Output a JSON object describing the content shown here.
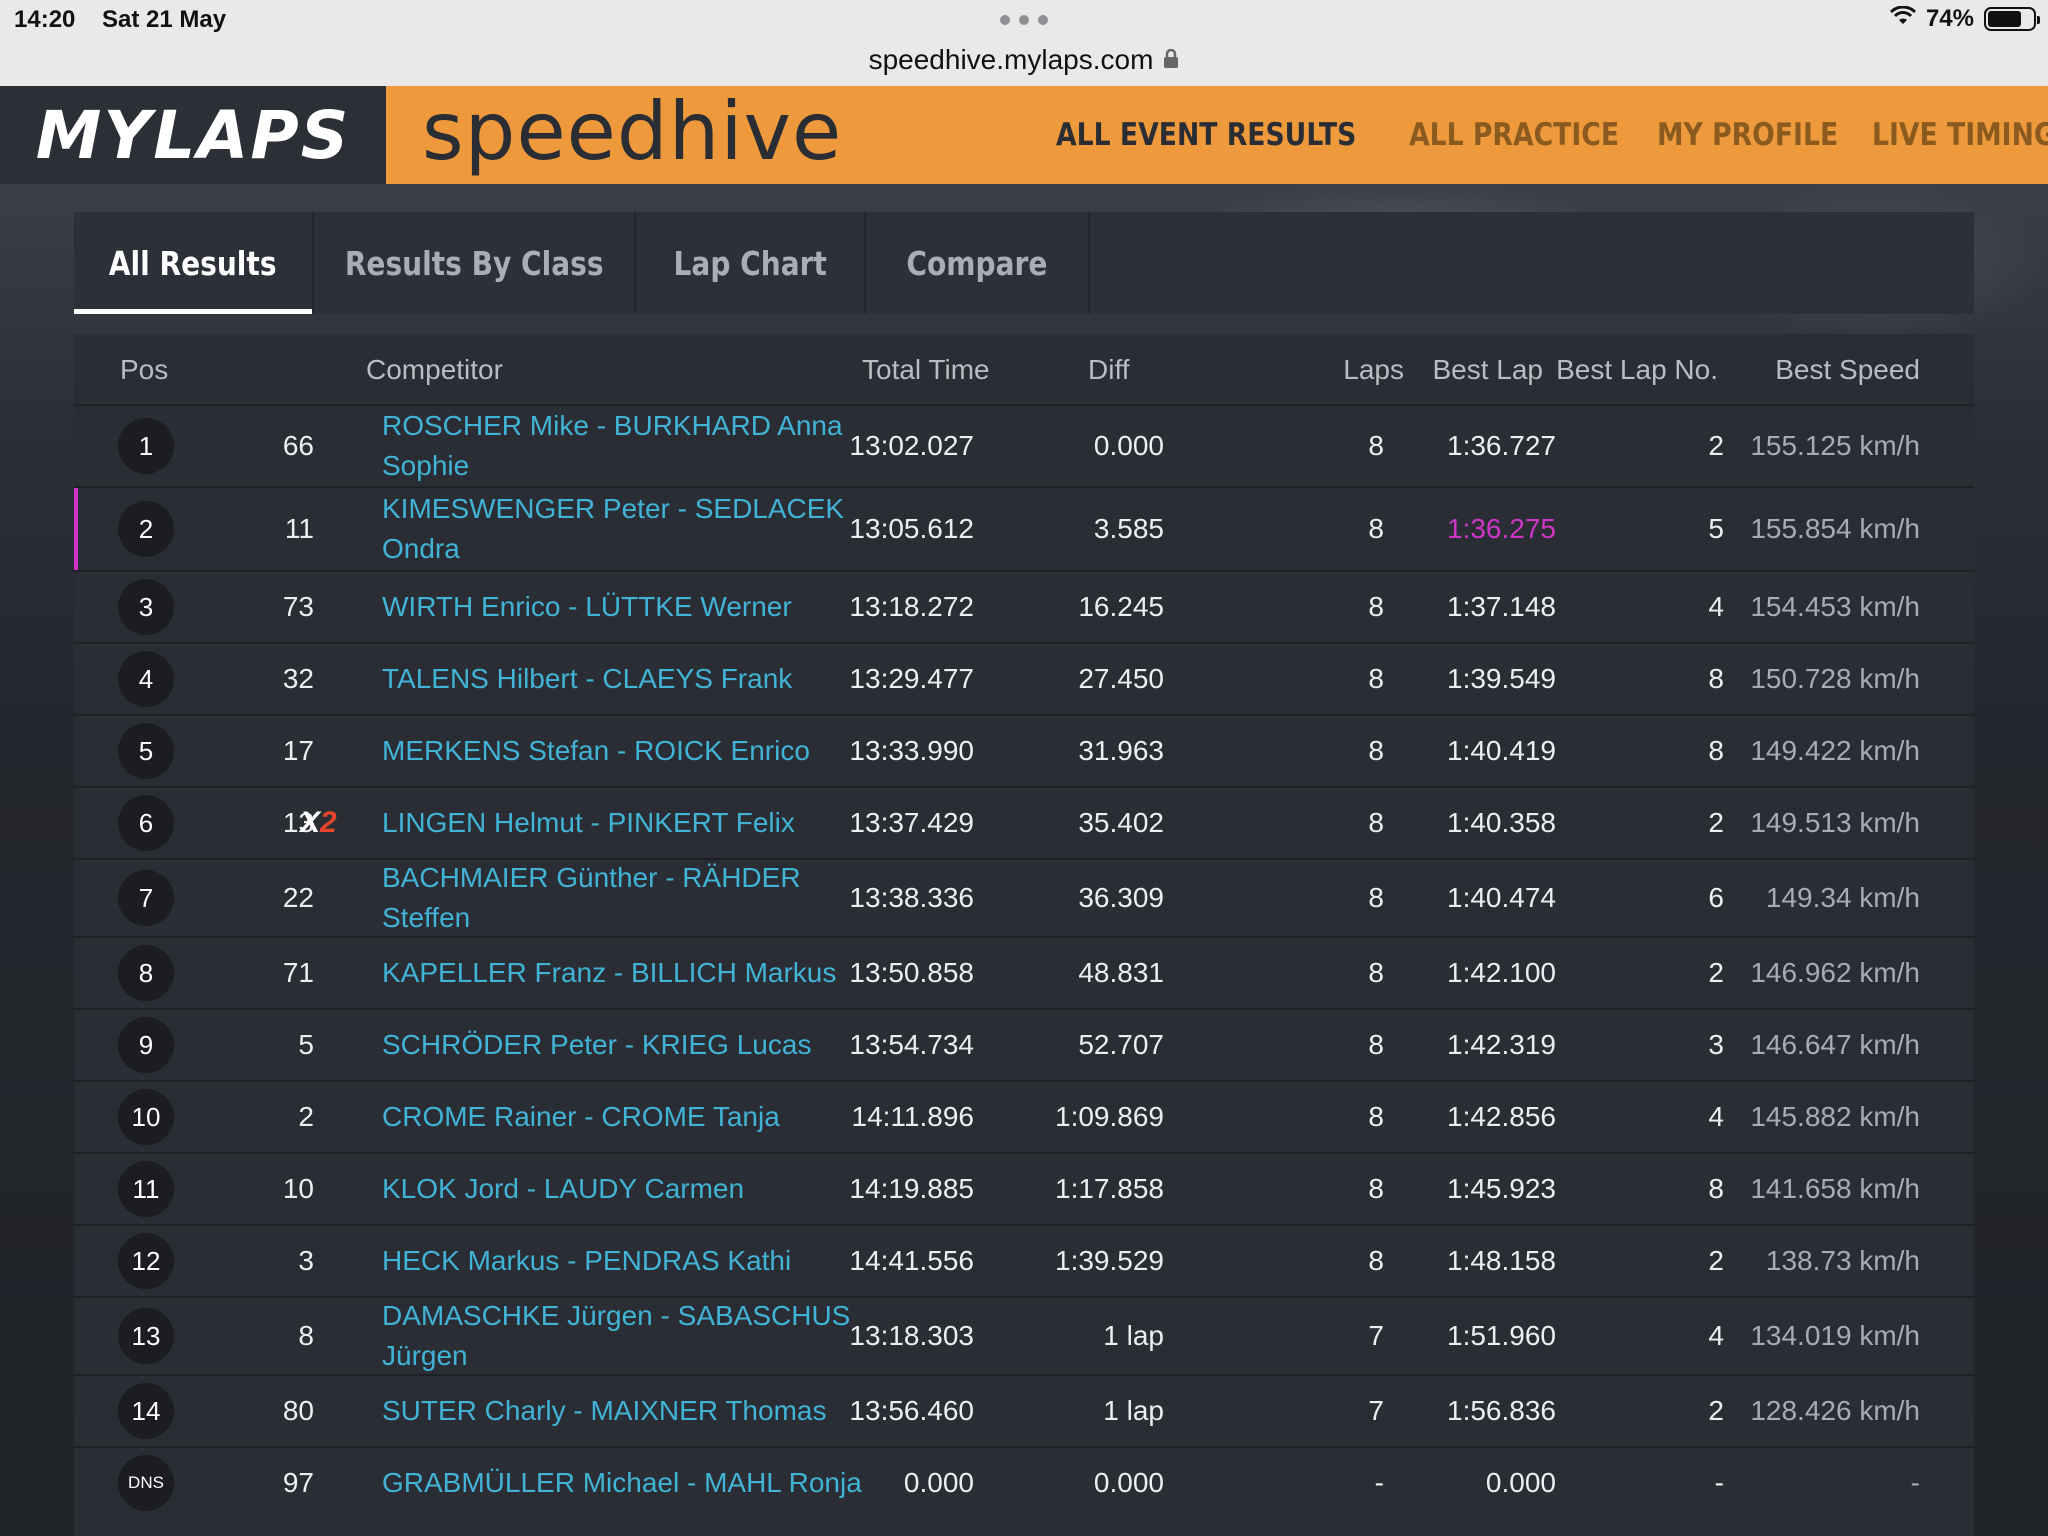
{
  "status_bar": {
    "time": "14:20",
    "date": "Sat 21 May",
    "battery": "74%",
    "battery_level": 0.74
  },
  "browser": {
    "url": "speedhive.mylaps.com"
  },
  "header": {
    "brand": "MYLAPS",
    "product": "speedhive",
    "nav": [
      {
        "label": "ALL EVENT RESULTS",
        "active": true
      },
      {
        "label": "ALL PRACTICE",
        "active": false
      },
      {
        "label": "MY PROFILE",
        "active": false
      },
      {
        "label": "LIVE TIMING",
        "active": false
      }
    ],
    "colors": {
      "brand_bar": "#ee9a3c",
      "brand_dark": "#2b2f36"
    }
  },
  "tabs": [
    {
      "label": "All Results",
      "active": true
    },
    {
      "label": "Results By Class",
      "active": false
    },
    {
      "label": "Lap Chart",
      "active": false
    },
    {
      "label": "Compare",
      "active": false
    }
  ],
  "table": {
    "columns": {
      "pos": "Pos",
      "competitor": "Competitor",
      "total_time": "Total Time",
      "diff": "Diff",
      "laps": "Laps",
      "best_lap": "Best Lap",
      "best_lap_no": "Best Lap No.",
      "best_speed": "Best Speed"
    },
    "colors": {
      "link": "#41b3d6",
      "fastest": "#cf35c7",
      "penalty": "#e8452c"
    },
    "rows": [
      {
        "pos": "1",
        "num": "66",
        "badge": "",
        "competitor": "ROSCHER Mike - BURKHARD Anna Sophie",
        "total": "13:02.027",
        "diff": "0.000",
        "laps": "8",
        "best_lap": "1:36.727",
        "best_lap_no": "2",
        "speed": "155.125 km/h"
      },
      {
        "pos": "2",
        "num": "11",
        "badge": "",
        "competitor": "KIMESWENGER Peter - SEDLACEK Ondra",
        "total": "13:05.612",
        "diff": "3.585",
        "laps": "8",
        "best_lap": "1:36.275",
        "best_lap_no": "5",
        "speed": "155.854 km/h",
        "fastest": true
      },
      {
        "pos": "3",
        "num": "73",
        "badge": "",
        "competitor": "WIRTH Enrico - LÜTTKE Werner",
        "total": "13:18.272",
        "diff": "16.245",
        "laps": "8",
        "best_lap": "1:37.148",
        "best_lap_no": "4",
        "speed": "154.453 km/h"
      },
      {
        "pos": "4",
        "num": "32",
        "badge": "",
        "competitor": "TALENS Hilbert - CLAEYS Frank",
        "total": "13:29.477",
        "diff": "27.450",
        "laps": "8",
        "best_lap": "1:39.549",
        "best_lap_no": "8",
        "speed": "150.728 km/h"
      },
      {
        "pos": "5",
        "num": "17",
        "badge": "",
        "competitor": "MERKENS Stefan - ROICK Enrico",
        "total": "13:33.990",
        "diff": "31.963",
        "laps": "8",
        "best_lap": "1:40.419",
        "best_lap_no": "8",
        "speed": "149.422 km/h"
      },
      {
        "pos": "6",
        "num": "13",
        "badge": "X2",
        "competitor": "LINGEN Helmut - PINKERT Felix",
        "total": "13:37.429",
        "diff": "35.402",
        "laps": "8",
        "best_lap": "1:40.358",
        "best_lap_no": "2",
        "speed": "149.513 km/h"
      },
      {
        "pos": "7",
        "num": "22",
        "badge": "",
        "competitor": "BACHMAIER Günther - RÄHDER Steffen",
        "total": "13:38.336",
        "diff": "36.309",
        "laps": "8",
        "best_lap": "1:40.474",
        "best_lap_no": "6",
        "speed": "149.34 km/h"
      },
      {
        "pos": "8",
        "num": "71",
        "badge": "",
        "competitor": "KAPELLER Franz - BILLICH Markus",
        "total": "13:50.858",
        "diff": "48.831",
        "laps": "8",
        "best_lap": "1:42.100",
        "best_lap_no": "2",
        "speed": "146.962 km/h"
      },
      {
        "pos": "9",
        "num": "5",
        "badge": "",
        "competitor": "SCHRÖDER Peter - KRIEG Lucas",
        "total": "13:54.734",
        "diff": "52.707",
        "laps": "8",
        "best_lap": "1:42.319",
        "best_lap_no": "3",
        "speed": "146.647 km/h"
      },
      {
        "pos": "10",
        "num": "2",
        "badge": "",
        "competitor": "CROME Rainer - CROME Tanja",
        "total": "14:11.896",
        "diff": "1:09.869",
        "laps": "8",
        "best_lap": "1:42.856",
        "best_lap_no": "4",
        "speed": "145.882 km/h"
      },
      {
        "pos": "11",
        "num": "10",
        "badge": "",
        "competitor": "KLOK Jord - LAUDY Carmen",
        "total": "14:19.885",
        "diff": "1:17.858",
        "laps": "8",
        "best_lap": "1:45.923",
        "best_lap_no": "8",
        "speed": "141.658 km/h"
      },
      {
        "pos": "12",
        "num": "3",
        "badge": "",
        "competitor": "HECK Markus - PENDRAS Kathi",
        "total": "14:41.556",
        "diff": "1:39.529",
        "laps": "8",
        "best_lap": "1:48.158",
        "best_lap_no": "2",
        "speed": "138.73 km/h"
      },
      {
        "pos": "13",
        "num": "8",
        "badge": "",
        "competitor": "DAMASCHKE Jürgen - SABASCHUS Jürgen",
        "total": "13:18.303",
        "diff": "1 lap",
        "laps": "7",
        "best_lap": "1:51.960",
        "best_lap_no": "4",
        "speed": "134.019 km/h"
      },
      {
        "pos": "14",
        "num": "80",
        "badge": "",
        "competitor": "SUTER Charly - MAIXNER Thomas",
        "total": "13:56.460",
        "diff": "1 lap",
        "laps": "7",
        "best_lap": "1:56.836",
        "best_lap_no": "2",
        "speed": "128.426 km/h"
      },
      {
        "pos": "DNS",
        "num": "97",
        "badge": "",
        "competitor": "GRABMÜLLER Michael - MAHL Ronja",
        "total": "0.000",
        "diff": "0.000",
        "laps": "-",
        "best_lap": "0.000",
        "best_lap_no": "-",
        "speed": "-"
      }
    ]
  }
}
